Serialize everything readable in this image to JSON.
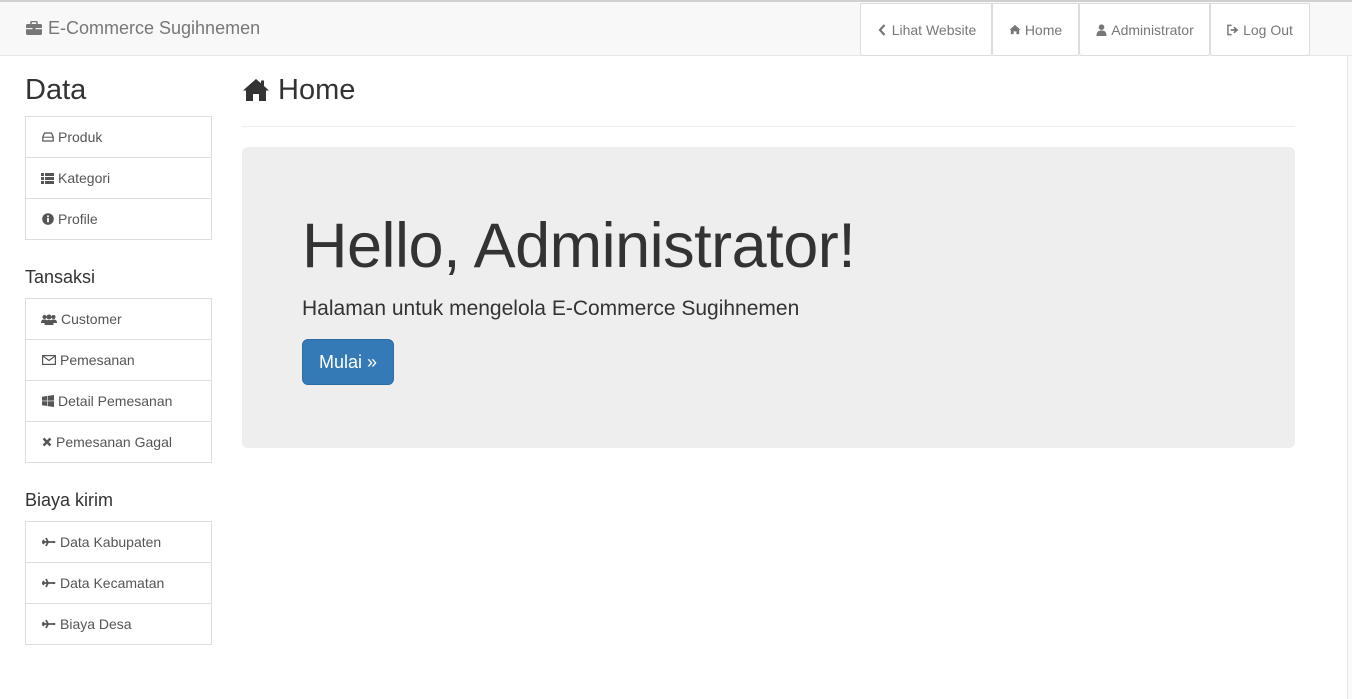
{
  "navbar": {
    "brand": "E-Commerce Sugihnemen",
    "buttons": {
      "website": "Lihat Website",
      "home": "Home",
      "admin": "Administrator",
      "logout": "Log Out"
    }
  },
  "sidebar": {
    "data_title": "Data",
    "data_items": [
      "Produk",
      "Kategori",
      "Profile"
    ],
    "transaksi_title": "Tansaksi",
    "transaksi_items": [
      "Customer",
      "Pemesanan",
      "Detail Pemesanan",
      "Pemesanan Gagal"
    ],
    "biaya_title": "Biaya kirim",
    "biaya_items": [
      "Data Kabupaten",
      "Data Kecamatan",
      "Biaya Desa"
    ]
  },
  "main": {
    "page_title": "Home",
    "jumbotron": {
      "heading": "Hello, Administrator!",
      "subtitle": "Halaman untuk mengelola E-Commerce Sugihnemen",
      "button": "Mulai »"
    }
  },
  "colors": {
    "primary": "#337ab7",
    "navbar_bg": "#f8f8f8",
    "jumbotron_bg": "#eeeeee"
  },
  "icons": {
    "brand": "briefcase-icon",
    "website": "chevron-left-icon",
    "home": "home-icon",
    "admin": "user-icon",
    "logout": "log-out-icon"
  }
}
